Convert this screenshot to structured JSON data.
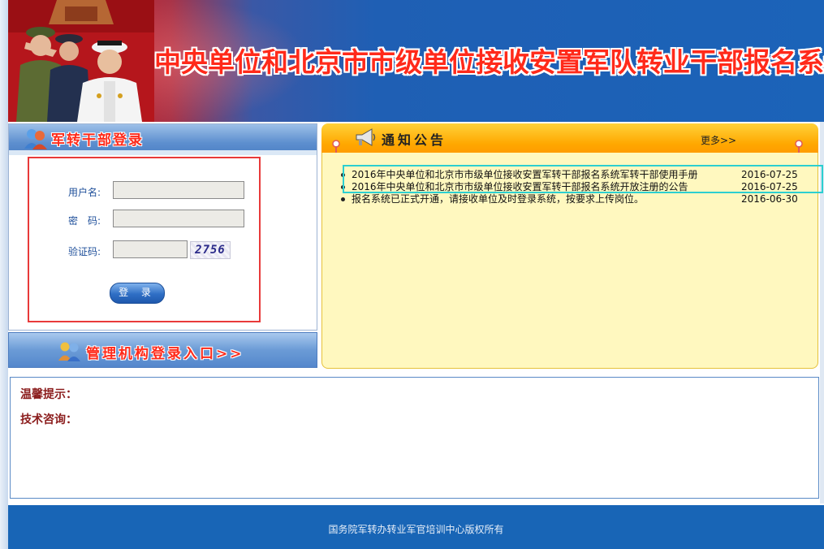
{
  "header": {
    "system_title": "中央单位和北京市市级单位接收安置军队转业干部报名系统"
  },
  "login": {
    "panel_title": "军转干部登录",
    "username_label": "用户名:",
    "username_value": "",
    "password_label": "密　码:",
    "password_value": "",
    "captcha_label": "验证码:",
    "captcha_value": "",
    "captcha_text": "2756",
    "submit_label": "登 录"
  },
  "admin_entry": {
    "label": "管理机构登录入口>>"
  },
  "notices": {
    "title": "通知公告",
    "more_label": "更多>>",
    "items": [
      {
        "title": "2016年中央单位和北京市市级单位接收安置军转干部报名系统军转干部使用手册",
        "date": "2016-07-25"
      },
      {
        "title": "2016年中央单位和北京市市级单位接收安置军转干部报名系统开放注册的公告",
        "date": "2016-07-25"
      },
      {
        "title": "报名系统已正式开通，请接收单位及时登录系统，按要求上传岗位。",
        "date": "2016-06-30"
      }
    ]
  },
  "tips": {
    "warm_tip_label": "温馨提示：",
    "tech_consult_label": "技术咨询："
  },
  "footer": {
    "copyright": "国务院军转办转业军官培训中心版权所有"
  },
  "colors": {
    "banner_blue": "#1b63b8",
    "title_red": "#ff2a1a",
    "notice_orange": "#ffa800",
    "notice_bg": "#fff8bf",
    "login_frame_red": "#e83a3a",
    "highlight_cyan": "#2ccfd0",
    "footer_blue": "#1865b6"
  }
}
